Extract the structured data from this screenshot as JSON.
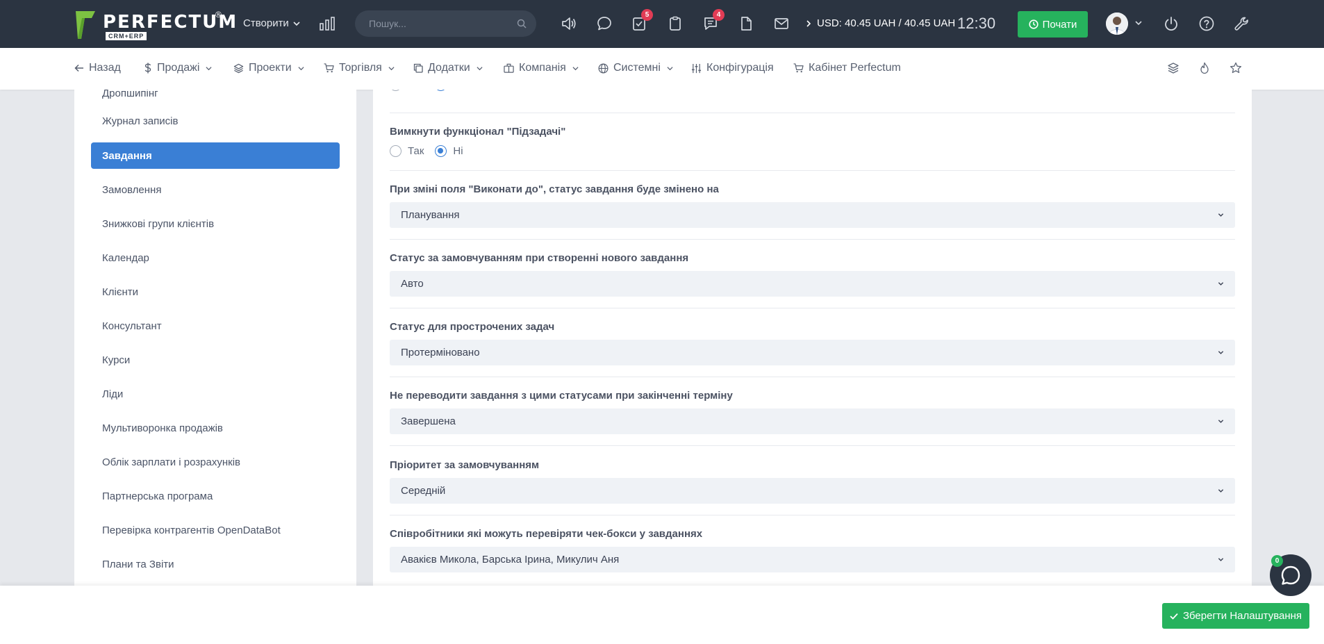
{
  "header": {
    "logo": {
      "name": "PERFECTUM",
      "reg": "®",
      "sub": "CRM+ERP"
    },
    "create_label": "Створити",
    "search_placeholder": "Пошук...",
    "badges": {
      "tasks": "5",
      "messages": "4"
    },
    "currency": "USD: 40.45 UAH / 40.45 UAH",
    "clock": "12:30",
    "start_label": "Почати"
  },
  "nav": {
    "back": "Назад",
    "items": [
      {
        "label": "Продажі",
        "icon": "dollar-icon"
      },
      {
        "label": "Проекти",
        "icon": "layers-icon"
      },
      {
        "label": "Торгівля",
        "icon": "cart-icon"
      },
      {
        "label": "Додатки",
        "icon": "copy-icon"
      },
      {
        "label": "Компанія",
        "icon": "building-icon"
      },
      {
        "label": "Системні",
        "icon": "globe-icon"
      },
      {
        "label": "Конфігурація",
        "icon": "sliders-icon"
      },
      {
        "label": "Кабінет Perfectum",
        "icon": "cart-icon"
      }
    ]
  },
  "sidebar": {
    "items": [
      {
        "label": "Дропшипінг"
      },
      {
        "label": "Журнал записів"
      },
      {
        "label": "Завдання",
        "active": true
      },
      {
        "label": "Замовлення"
      },
      {
        "label": "Знижкові групи клієнтів"
      },
      {
        "label": "Календар"
      },
      {
        "label": "Клієнти"
      },
      {
        "label": "Консультант"
      },
      {
        "label": "Курси"
      },
      {
        "label": "Ліди"
      },
      {
        "label": "Мультиворонка продажів"
      },
      {
        "label": "Облік зарплати і розрахунків"
      },
      {
        "label": "Партнерська програма"
      },
      {
        "label": "Перевірка контрагентів OpenDataBot"
      },
      {
        "label": "Плани та Звіти"
      }
    ]
  },
  "settings": {
    "radio_yes": "Так",
    "radio_no": "Ні",
    "subtasks_label": "Вимкнути функціонал \"Підзадачі\"",
    "fields": [
      {
        "label": "При зміні поля \"Виконати до\", статус завдання буде змінено на",
        "value": "Планування"
      },
      {
        "label": "Статус за замовчуванням при створенні нового завдання",
        "value": "Авто"
      },
      {
        "label": "Статус для прострочених задач",
        "value": "Протерміновано"
      },
      {
        "label": "Не переводити завдання з цими статусами при закінченні терміну",
        "value": "Завершена"
      },
      {
        "label": "Пріоритет за замовчуванням",
        "value": "Середній"
      },
      {
        "label": "Співробітники які можуть перевіряти чек-бокси у завданнях",
        "value": "Авакієв Микола, Барська Ірина, Микулич Аня"
      }
    ]
  },
  "footer": {
    "save_label": "Зберегти Налаштування"
  },
  "chat": {
    "badge": "0"
  },
  "colors": {
    "header_bg": "#2b3441",
    "accent_green": "#26b25d",
    "accent_blue": "#3a7fd5",
    "badge_red": "#e23c55"
  }
}
